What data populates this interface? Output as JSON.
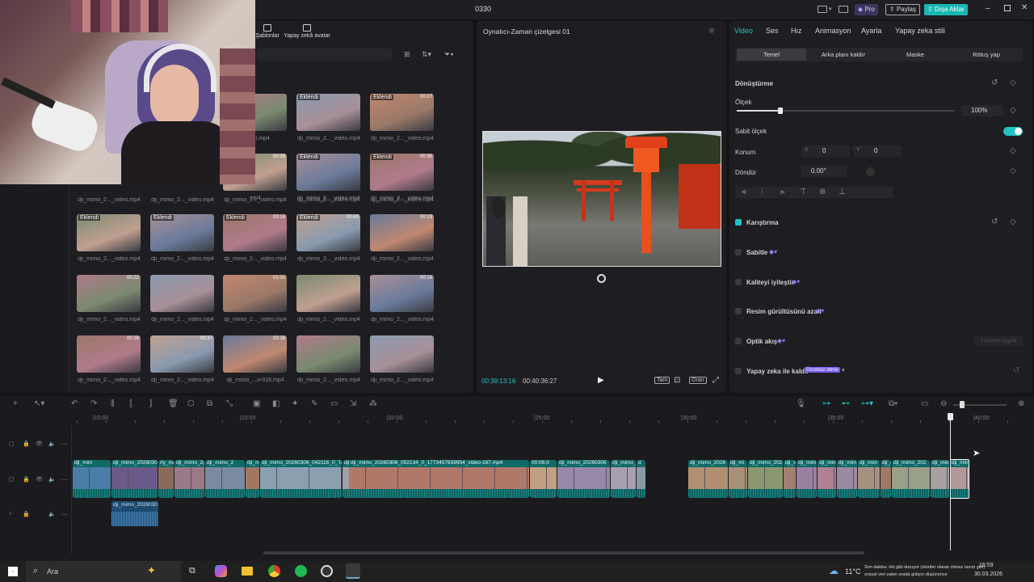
{
  "titlebar": {
    "title": "0330",
    "pro_label": "Pro",
    "share_label": "Paylaş",
    "export_label": "Dışa Aktar"
  },
  "media": {
    "tab_templates": "Şablonlar",
    "tab_ai_avatar": "Yapay zekâ avatar",
    "thumbs": [
      {
        "row": 0,
        "col": 0,
        "name": "deo(1).mp4",
        "badge": "",
        "dur": ""
      },
      {
        "row": 0,
        "col": 1,
        "name": "dji_mimo_2..._video.mp4",
        "badge": "Eklendi",
        "dur": ""
      },
      {
        "row": 0,
        "col": 2,
        "name": "dji_mimo_2..._video.mp4",
        "badge": "Eklendi",
        "dur": "00:27"
      },
      {
        "row": 1,
        "col": 0,
        "name": "mp4",
        "badge": "",
        "dur": "00:39"
      },
      {
        "row": 1,
        "col": 1,
        "name": "dji_mimo_2..._video.mp4",
        "badge": "Eklendi",
        "dur": ""
      },
      {
        "row": 1,
        "col": 2,
        "name": "dji_mimo_2..._video.mp4",
        "badge": "Eklendi",
        "dur": "00:36"
      },
      {
        "row": 2,
        "col": -2,
        "name": "dji_mimo_2..._video.mp4",
        "badge": "",
        "dur": ""
      },
      {
        "row": 2,
        "col": -1,
        "name": "dji_mimo_2..._video.mp4",
        "badge": "",
        "dur": ""
      },
      {
        "row": 2,
        "col": 0,
        "name": "dji_mimo_2..._video.mp4",
        "badge": "",
        "dur": ""
      },
      {
        "row": 2,
        "col": 1,
        "name": "dji_mimo_2..._video.mp4",
        "badge": "",
        "dur": ""
      },
      {
        "row": 2,
        "col": 2,
        "name": "dji_mimo_2..._video.mp4",
        "badge": "",
        "dur": ""
      },
      {
        "row": 3,
        "col": -2,
        "name": "dji_mimo_2..._video.mp4",
        "badge": "Eklendi",
        "dur": ""
      },
      {
        "row": 3,
        "col": -1,
        "name": "dji_mimo_2..._video.mp4",
        "badge": "Eklendi",
        "dur": ""
      },
      {
        "row": 3,
        "col": 0,
        "name": "dji_mimo_2..._video.mp4",
        "badge": "Eklendi",
        "dur": "00:14"
      },
      {
        "row": 3,
        "col": 1,
        "name": "dji_mimo_2..._video.mp4",
        "badge": "Eklendi",
        "dur": "00:40"
      },
      {
        "row": 3,
        "col": 2,
        "name": "dji_mimo_2..._video.mp4",
        "badge": "",
        "dur": "00:19"
      },
      {
        "row": 4,
        "col": -2,
        "name": "dji_mimo_2..._video.mp4",
        "badge": "",
        "dur": "00:22"
      },
      {
        "row": 4,
        "col": -1,
        "name": "dji_mimo_2..._video.mp4",
        "badge": "",
        "dur": ""
      },
      {
        "row": 4,
        "col": 0,
        "name": "dji_mimo_2..._video.mp4",
        "badge": "",
        "dur": "01:02"
      },
      {
        "row": 4,
        "col": 1,
        "name": "dji_mimo_2..._video.mp4",
        "badge": "",
        "dur": ""
      },
      {
        "row": 4,
        "col": 2,
        "name": "dji_mimo_2..._video.mp4",
        "badge": "",
        "dur": "00:14"
      },
      {
        "row": 5,
        "col": -2,
        "name": "dji_mimo_2..._video.mp4",
        "badge": "",
        "dur": "00:16"
      },
      {
        "row": 5,
        "col": -1,
        "name": "dji_mimo_2..._video.mp4",
        "badge": "",
        "dur": "00:37"
      },
      {
        "row": 5,
        "col": 0,
        "name": "dji_mimo_...o-016.mp4",
        "badge": "",
        "dur": "00:16"
      },
      {
        "row": 5,
        "col": 1,
        "name": "dji_mimo_2..._video.mp4",
        "badge": "",
        "dur": ""
      },
      {
        "row": 5,
        "col": 2,
        "name": "dji_mimo_2..._video.mp4",
        "badge": "",
        "dur": ""
      }
    ]
  },
  "player": {
    "title": "Oynatıcı-Zaman çizelgesi 01",
    "current_time": "00:39:13:16",
    "total_time": "00:40:36:27",
    "full_label": "Tam",
    "ratio_label": "Oran"
  },
  "props": {
    "tabs": [
      "Video",
      "Ses",
      "Hız",
      "Animasyon",
      "Ayarla",
      "Yapay zeka stili"
    ],
    "subtabs": [
      "Temel",
      "Arka planı kaldır",
      "Maske",
      "Rötuş yap"
    ],
    "transform_label": "Dönüştürme",
    "scale_label": "Ölçek",
    "scale_value": "100%",
    "scale_fraction": 0.1,
    "uniform_scale_label": "Sabit ölçek",
    "position_label": "Konum",
    "x_label": "X",
    "x_value": "0",
    "y_label": "Y",
    "y_value": "0",
    "rotate_label": "Döndür",
    "rotate_value": "0.00°",
    "blend_label": "Karıştırma",
    "stabilize_label": "Sabitle",
    "enhance_label": "Kaliteyi iyileştir",
    "denoise_label": "Resim gürültüsünü azalt",
    "optical_flow_label": "Optik akış",
    "apply_all_label": "Tümüne uygula",
    "ai_remove_label": "Yapay zeka ile kaldır",
    "free_trial_label": "Ücretsiz dene"
  },
  "timeline": {
    "ruler": [
      "10:00",
      "15:00",
      "20:00",
      "25:00",
      "30:00",
      "35:00",
      "40:00"
    ],
    "clips": [
      {
        "label": "dji_mim",
        "w": 48,
        "c": "#4a7ea8"
      },
      {
        "label": "dji_mimo_20260306_",
        "w": 58,
        "c": "#6a5a8a"
      },
      {
        "label": "rly_mim",
        "w": 20,
        "c": "#8a6a5a"
      },
      {
        "label": "dji_mimo_2(",
        "w": 38,
        "c": "#9a7a88"
      },
      {
        "label": "dji_mimo_2",
        "w": 50,
        "c": "#7a8aa0"
      },
      {
        "label": "dji_m",
        "w": 18,
        "c": "#a07860"
      },
      {
        "label": "dji_mimo_20260306_042116_0_Ti",
        "w": 102,
        "c": "#8aa0b0"
      },
      {
        "label": "dji_m",
        "w": 18,
        "c": "#a0a0a8"
      },
      {
        "label": "dji_mimo_20260306_052134_0_1773457939954_video-167.mp4",
        "w": 224,
        "c": "#b07868"
      },
      {
        "label": "00:06:0",
        "w": 34,
        "c": "#c0a080"
      },
      {
        "label": "dji_mimo_20260306",
        "w": 66,
        "c": "#9888a8"
      },
      {
        "label": "dji_mimo_",
        "w": 32,
        "c": "#a8a0b0"
      },
      {
        "label": "d",
        "w": 12,
        "c": "#8a9aa8"
      },
      {
        "label": "dji_mimo_2026",
        "w": 50,
        "c": "#b09070"
      },
      {
        "label": "dji_mi",
        "w": 24,
        "c": "#a89078"
      },
      {
        "label": "dji_mimo_202",
        "w": 44,
        "c": "#8a9870"
      },
      {
        "label": "dji_m",
        "w": 16,
        "c": "#a08070"
      },
      {
        "label": "dji_mim",
        "w": 26,
        "c": "#9a80a0"
      },
      {
        "label": "dji_mim",
        "w": 24,
        "c": "#b08090"
      },
      {
        "label": "dji_mim",
        "w": 26,
        "c": "#9a8aa0"
      },
      {
        "label": "dji_mim",
        "w": 28,
        "c": "#a89080"
      },
      {
        "label": "dji_r",
        "w": 14,
        "c": "#a07868"
      },
      {
        "label": "dji_mimo_202",
        "w": 48,
        "c": "#98a088"
      },
      {
        "label": "dji_mim",
        "w": 24,
        "c": "#a8a0a0"
      },
      {
        "label": "dji_mim",
        "w": 24,
        "c": "#b09898"
      }
    ],
    "audio_clip_label": "dji_mimo_2026030"
  },
  "taskbar": {
    "search_label": "Ara",
    "temperature": "11°C",
    "news_line1": "Son dakika: ölü gibi duruyor (otoriter olarak olması lazım gibi)",
    "news_line2": "sosyal veri zaten orada gidiyor düşününce",
    "time": "16:59",
    "date": "30.03.2026"
  },
  "colors": {
    "accent": "#20c4c0",
    "clip": "#0f6a68",
    "pro": "#6b5bd6"
  }
}
